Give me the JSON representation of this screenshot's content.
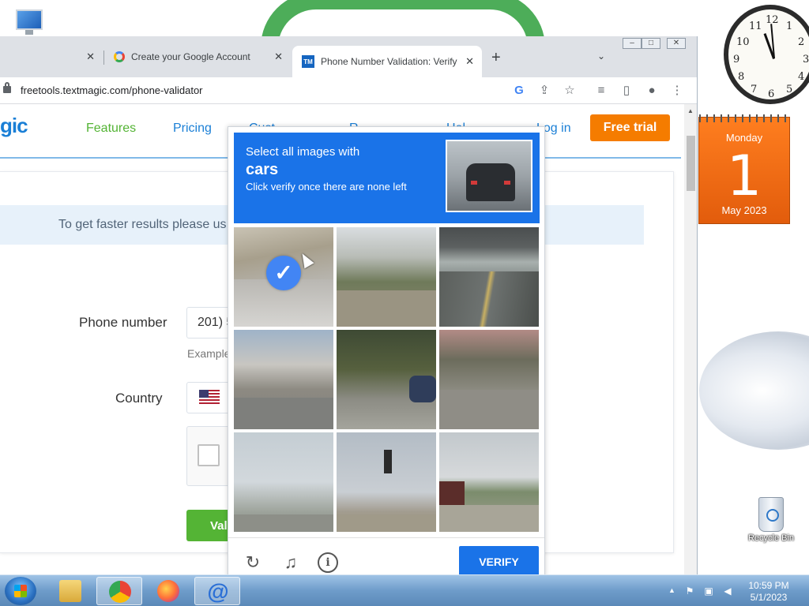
{
  "browser": {
    "tabs": [
      {
        "label": ""
      },
      {
        "label": "Create your Google Account"
      },
      {
        "label": "Phone Number Validation: Verify",
        "favicon": "TM"
      }
    ],
    "url": "freetools.textmagic.com/phone-validator"
  },
  "site": {
    "logo_text": "gic",
    "nav": [
      "Features",
      "Pricing",
      "Cust",
      "R",
      "Hel"
    ],
    "login": "Log in",
    "free_trial": "Free trial",
    "tip_text": "To get faster results please us",
    "phone_label": "Phone number",
    "phone_value": "201) 5",
    "example_label": "Example",
    "country_label": "Country",
    "validate_label": "Vali"
  },
  "captcha": {
    "line1": "Select all images with",
    "keyword": "cars",
    "line3": "Click verify once there are none left",
    "verify_label": "VERIFY",
    "tiles_selected": [
      true,
      false,
      false,
      false,
      false,
      false,
      false,
      false,
      false
    ]
  },
  "desktop": {
    "calendar_dow": "Monday",
    "calendar_day": "1",
    "calendar_month_year": "May 2023",
    "recycle_bin": "Recycle Bin",
    "clock_numbers": [
      "12",
      "1",
      "2",
      "3",
      "4",
      "5",
      "6",
      "7",
      "8",
      "9",
      "10",
      "11"
    ]
  },
  "taskbar": {
    "time": "10:59 PM",
    "date": "5/1/2023"
  },
  "colors": {
    "accent_blue": "#1a73e8",
    "site_green": "#54b435",
    "site_orange": "#f57c00",
    "site_blue": "#1a7fd6"
  }
}
